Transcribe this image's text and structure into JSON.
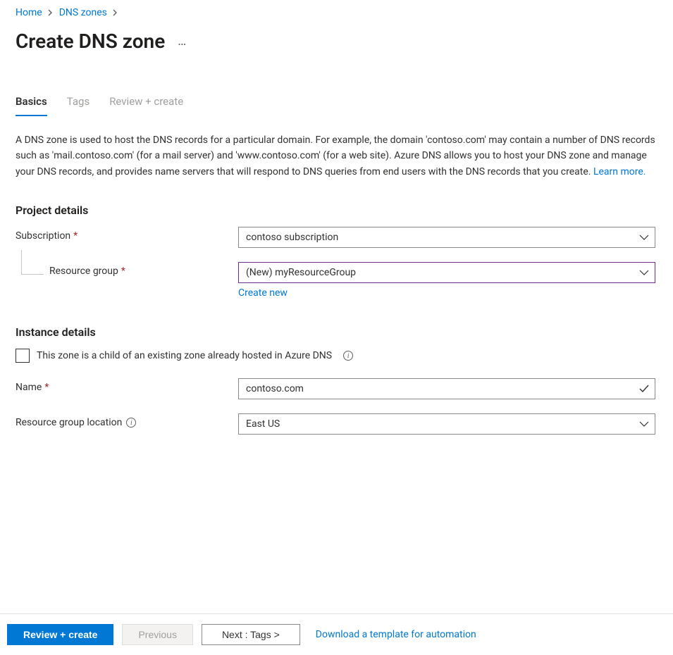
{
  "breadcrumb": {
    "home": "Home",
    "dnszones": "DNS zones"
  },
  "title": "Create DNS zone",
  "tabs": {
    "basics": "Basics",
    "tags": "Tags",
    "review": "Review + create"
  },
  "description": {
    "text": "A DNS zone is used to host the DNS records for a particular domain. For example, the domain 'contoso.com' may contain a number of DNS records such as 'mail.contoso.com' (for a mail server) and 'www.contoso.com' (for a web site). Azure DNS allows you to host your DNS zone and manage your DNS records, and provides name servers that will respond to DNS queries from end users with the DNS records that you create.  ",
    "learn_more": "Learn more."
  },
  "sections": {
    "project": "Project details",
    "instance": "Instance details"
  },
  "labels": {
    "subscription": "Subscription",
    "resource_group": "Resource group",
    "create_new": "Create new",
    "child_zone": "This zone is a child of an existing zone already hosted in Azure DNS",
    "name": "Name",
    "rg_location": "Resource group location"
  },
  "values": {
    "subscription": "contoso subscription",
    "resource_group": "(New) myResourceGroup",
    "name": "contoso.com",
    "rg_location": "East US"
  },
  "footer": {
    "review": "Review + create",
    "previous": "Previous",
    "next": "Next : Tags >",
    "download": "Download a template for automation"
  }
}
